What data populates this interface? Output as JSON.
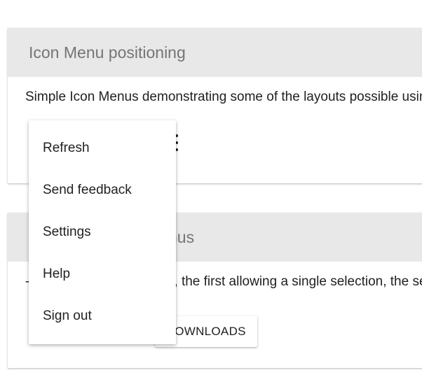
{
  "card1": {
    "title": "Icon Menu positioning",
    "description": "Simple Icon Menus demonstrating some of the layouts possible using the anchorOrigin and targetOrigin properties."
  },
  "card2": {
    "title_visible": "nus",
    "description_prefix": "-",
    "description_visible": "es, the first allowing a single selection, the second multiple selections.",
    "button_label_visible": "OWNLOADS"
  },
  "menu": {
    "items": [
      {
        "label": "Refresh"
      },
      {
        "label": "Send feedback"
      },
      {
        "label": "Settings"
      },
      {
        "label": "Help"
      },
      {
        "label": "Sign out"
      }
    ]
  },
  "icons": {
    "menu_trigger": "more-vert-icon"
  },
  "colors": {
    "card_header_bg": "#e8e8e8",
    "card_header_text": "#757575",
    "body_text": "#212121"
  }
}
